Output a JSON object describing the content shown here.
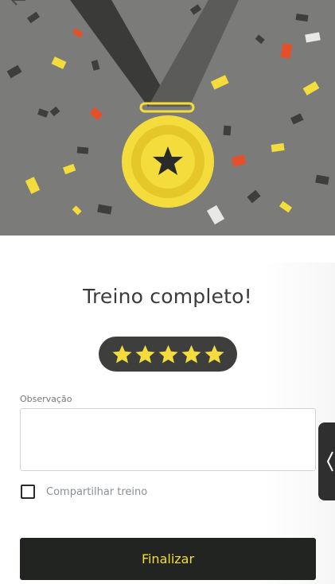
{
  "colors": {
    "hero_background": "#7b7c7a",
    "ribbon_dark": "#3a3b38",
    "ribbon_light": "#5b5c5a",
    "medal_gold": "#f4dc3c",
    "medal_inner": "#e6c72a",
    "confetti_yellow": "#f4dc3c",
    "confetti_red": "#e4502a",
    "confetti_dark": "#3e3f3c",
    "confetti_white": "#e8e8e8",
    "button_background": "#222421",
    "button_text": "#f4dc3c",
    "rating_pill": "#3e3f3c"
  },
  "header": {
    "back_icon": "arrow-left-icon"
  },
  "hero": {
    "illustration": "medal-with-confetti",
    "medal_icon": "star-icon"
  },
  "main": {
    "title": "Treino completo!",
    "rating": {
      "value": 5,
      "max": 5,
      "icon": "star-icon"
    },
    "observation": {
      "label": "Observação",
      "value": "",
      "placeholder": ""
    },
    "share": {
      "label": "Compartilhar treino",
      "checked": false
    },
    "finish_button": "Finalizar"
  },
  "side_panel": {
    "icon": "chevron-left-icon"
  }
}
